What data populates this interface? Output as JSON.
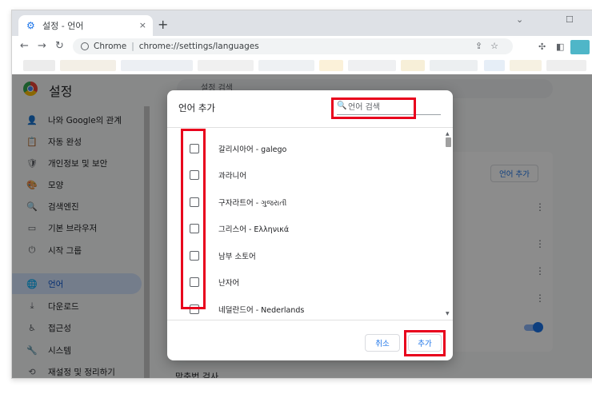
{
  "browser": {
    "tab_title": "설정 - 언어",
    "tab_close": "×",
    "new_tab": "+",
    "win_minimize": "⌄",
    "win_restore": "☐",
    "site_label": "Chrome",
    "separator": "|",
    "url": "chrome://settings/languages",
    "nav_back": "←",
    "nav_forward": "→",
    "nav_reload": "↻",
    "share_icon": "⇪",
    "star_icon": "☆",
    "extensions_icon": "✣",
    "sidepanel_icon": "◧"
  },
  "settings": {
    "title": "설정",
    "search_placeholder": "설정 검색",
    "sidebar": [
      {
        "label": "나와 Google의 관계",
        "icon": "person-icon",
        "glyph": "👤"
      },
      {
        "label": "자동 완성",
        "icon": "clipboard-icon",
        "glyph": "📋"
      },
      {
        "label": "개인정보 및 보안",
        "icon": "shield-icon",
        "glyph": "🛡"
      },
      {
        "label": "모양",
        "icon": "palette-icon",
        "glyph": "🎨"
      },
      {
        "label": "검색엔진",
        "icon": "search-icon",
        "glyph": "🔍"
      },
      {
        "label": "기본 브라우저",
        "icon": "browser-icon",
        "glyph": "▭"
      },
      {
        "label": "시작 그룹",
        "icon": "power-icon",
        "glyph": "⏻"
      },
      {
        "label": "언어",
        "icon": "globe-icon",
        "glyph": "🌐",
        "active": true
      },
      {
        "label": "다운로드",
        "icon": "download-icon",
        "glyph": "⤓"
      },
      {
        "label": "접근성",
        "icon": "accessibility-icon",
        "glyph": "♿"
      },
      {
        "label": "시스템",
        "icon": "wrench-icon",
        "glyph": "🔧"
      },
      {
        "label": "재설정 및 정리하기",
        "icon": "reset-icon",
        "glyph": "⟲"
      }
    ],
    "card_button": "언어 추가",
    "kebab": "⋮",
    "bottom_label": "맞춤법 검사"
  },
  "dialog": {
    "title": "언어 추가",
    "search_placeholder": "언어 검색",
    "search_glyph": "🔍",
    "languages": [
      "갈리시아어 - galego",
      "과라니어",
      "구자라트어 - ગુજરાતી",
      "그리스어 - Ελληνικά",
      "남부 소토어",
      "난자어",
      "네덜란드어 - Nederlands"
    ],
    "scroll_up": "▲",
    "scroll_down": "▼",
    "cancel_label": "취소",
    "add_label": "추가"
  },
  "colors": {
    "highlight": "#e8001c",
    "accent": "#1a73e8"
  }
}
